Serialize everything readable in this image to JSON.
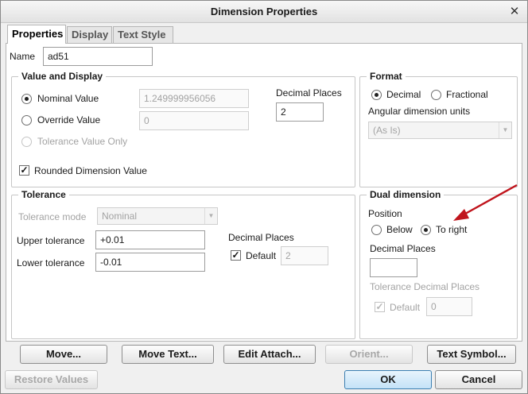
{
  "window": {
    "title": "Dimension Properties",
    "close_glyph": "✕"
  },
  "tabs": [
    {
      "label": "Properties"
    },
    {
      "label": "Display"
    },
    {
      "label": "Text Style"
    }
  ],
  "name": {
    "label": "Name",
    "value": "ad51"
  },
  "value_display": {
    "title": "Value and Display",
    "nominal_label": "Nominal Value",
    "nominal_value": "1.249999956056",
    "override_label": "Override Value",
    "override_value": "0",
    "tolerance_only_label": "Tolerance Value Only",
    "rounded_label": "Rounded Dimension Value",
    "decimal_places_label": "Decimal Places",
    "decimal_places_value": "2"
  },
  "format": {
    "title": "Format",
    "decimal_label": "Decimal",
    "fractional_label": "Fractional",
    "angular_label": "Angular dimension units",
    "angular_value": "(As Is)"
  },
  "tolerance": {
    "title": "Tolerance",
    "mode_label": "Tolerance mode",
    "mode_value": "Nominal",
    "upper_label": "Upper tolerance",
    "upper_value": "+0.01",
    "lower_label": "Lower tolerance",
    "lower_value": "-0.01",
    "decimal_places_label": "Decimal Places",
    "default_label": "Default",
    "default_value": "2"
  },
  "dual": {
    "title": "Dual dimension",
    "position_label": "Position",
    "below_label": "Below",
    "to_right_label": "To right",
    "decimal_places_label": "Decimal Places",
    "decimal_places_value": "",
    "tol_decimal_label": "Tolerance Decimal Places",
    "default_label": "Default",
    "default_value": "0"
  },
  "buttons": {
    "move": "Move...",
    "move_text": "Move Text...",
    "edit_attach": "Edit Attach...",
    "orient": "Orient...",
    "text_symbol": "Text Symbol...",
    "restore": "Restore Values",
    "ok": "OK",
    "cancel": "Cancel"
  },
  "icons": {
    "check_glyph": "✓",
    "dropdown_glyph": "▼"
  },
  "colors": {
    "annotation_arrow": "#c0141c",
    "ok_accent": "#c4e2f7"
  }
}
